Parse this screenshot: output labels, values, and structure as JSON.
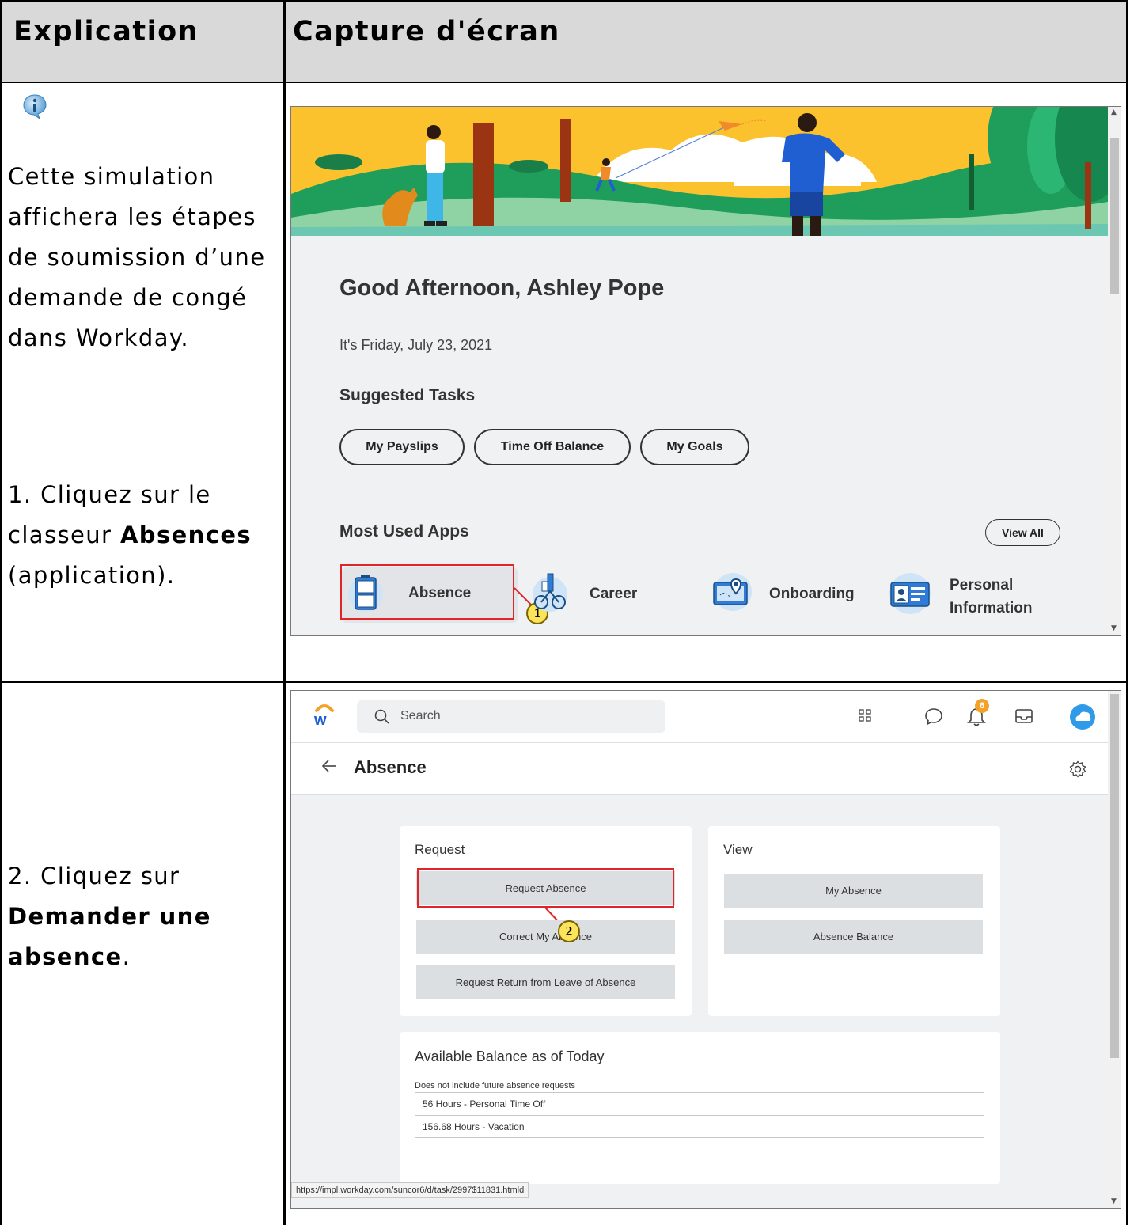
{
  "table": {
    "col1_header": "Explication",
    "col2_header": "Capture d'écran"
  },
  "step1": {
    "intro_icon": "info-speech-bubble-icon",
    "intro_text": "Cette simulation affichera les étapes de soumission d’une demande de congé dans Workday.",
    "instruction_prefix": "1. Cliquez sur le classeur ",
    "instruction_bold": "Absences",
    "instruction_suffix": " (application).",
    "screen": {
      "greeting": "Good Afternoon, Ashley Pope",
      "date": "It's Friday, July 23, 2021",
      "suggested_title": "Suggested Tasks",
      "suggested_tasks": [
        "My Payslips",
        "Time Off Balance",
        "My Goals"
      ],
      "apps_title": "Most Used Apps",
      "view_all": "View All",
      "apps": [
        {
          "label": "Absence",
          "icon": "filing-cabinet-icon"
        },
        {
          "label": "Career",
          "icon": "career-ladder-icon"
        },
        {
          "label": "Onboarding",
          "icon": "map-pin-icon"
        },
        {
          "label": "Personal Information",
          "icon": "id-card-icon"
        }
      ],
      "marker": "1"
    }
  },
  "step2": {
    "instruction_prefix": "2. Cliquez sur ",
    "instruction_bold": "Demander une absence",
    "instruction_suffix": ".",
    "screen": {
      "search_placeholder": "Search",
      "notification_count": "6",
      "page_title": "Absence",
      "request_title": "Request",
      "request_buttons": [
        "Request Absence",
        "Correct My Absence",
        "Request Return from Leave of Absence"
      ],
      "view_title": "View",
      "view_buttons": [
        "My Absence",
        "Absence Balance"
      ],
      "balance_title": "Available Balance as of Today",
      "balance_note": "Does not include future absence requests",
      "balances": [
        "56 Hours - Personal Time Off",
        "156.68 Hours - Vacation"
      ],
      "status_url": "https://impl.workday.com/suncor6/d/task/2997$11831.htmld",
      "marker": "2"
    }
  },
  "colors": {
    "header_bg": "#d9d9d9",
    "callout": "#e0242a",
    "marker_fill": "#fbe35a",
    "workday_bg": "#f0f1f2",
    "banner_sky": "#fcc22d",
    "banner_hill": "#1e9e5a"
  }
}
